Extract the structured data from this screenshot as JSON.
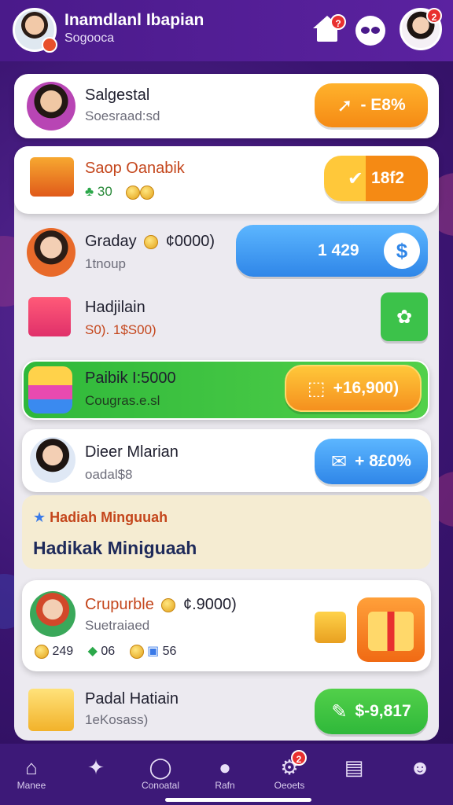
{
  "header": {
    "title": "Inamdlanl Ibapian",
    "subtitle": "Sogooca",
    "home_badge": "?",
    "profile_badge": "2"
  },
  "cards": [
    {
      "title": "Salgestal",
      "subtitle": "Soesraad:sd",
      "button": "- E8%",
      "button_icon": "arrow"
    },
    {
      "title": "Saop Oanabik",
      "subtitle": "",
      "stats": "30",
      "button": "18f2",
      "button_icon": "check"
    },
    {
      "title": "Graday",
      "title_extra": "¢0000)",
      "subtitle": "1tnoup",
      "button": "1 429",
      "button_icon": "dollar"
    },
    {
      "title": "Hadjilain",
      "subtitle": "S0). 1$S00)",
      "button_icon": "clover"
    },
    {
      "title": "Paibik I:5000",
      "subtitle": "Cougras.e.sl",
      "button": "+16,900)",
      "button_icon": "box"
    },
    {
      "title": "Dieer Mlarian",
      "subtitle": "oadal$8",
      "button": "+ 8£0%",
      "button_icon": "ticket"
    },
    {
      "title": "Crupurble",
      "title_extra": "¢.9000)",
      "subtitle": "Suetraiaed",
      "stats": [
        "249",
        "06",
        "56"
      ]
    },
    {
      "title": "Padal Hatiain",
      "subtitle": "1eKosass)",
      "button": "$-9,817",
      "button_icon": "money"
    }
  ],
  "weekly": {
    "label": "Hadiah Minguuah",
    "headline": "Hadikak Miniguaah"
  },
  "nav": {
    "items": [
      {
        "label": "Manee",
        "icon": "home-icon"
      },
      {
        "label": "",
        "icon": "game-icon"
      },
      {
        "label": "Conoatal",
        "icon": "search-icon"
      },
      {
        "label": "Rafn",
        "icon": "compass-icon"
      },
      {
        "label": "Oeoets",
        "icon": "settings-icon",
        "badge": "2"
      },
      {
        "label": "",
        "icon": "calendar-icon"
      },
      {
        "label": "",
        "icon": "user-icon"
      }
    ]
  },
  "colors": {
    "primary": "#4a1a8a",
    "orange": "#f5901e",
    "blue": "#3b9cf0",
    "green": "#3cc24a"
  }
}
